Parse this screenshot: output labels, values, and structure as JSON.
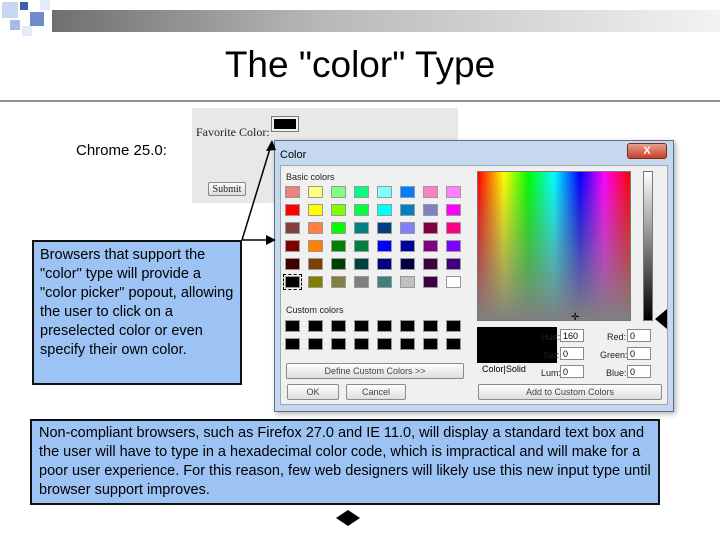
{
  "slide": {
    "title": "The \"color\" Type"
  },
  "chrome_example": {
    "browser_label": "Chrome 25.0:",
    "favorite_label": "Favorite Color:",
    "submit_label": "Submit"
  },
  "color_dialog": {
    "title": "Color",
    "close_label": "X",
    "basic_colors_label": "Basic colors",
    "custom_colors_label": "Custom colors",
    "define_custom_label": "Define Custom Colors >>",
    "ok_label": "OK",
    "cancel_label": "Cancel",
    "add_custom_label": "Add to Custom Colors",
    "color_solid_label": "Color|Solid",
    "fields": {
      "hue": {
        "label": "Hue:",
        "value": "160"
      },
      "sat": {
        "label": "Sat:",
        "value": "0"
      },
      "lum": {
        "label": "Lum:",
        "value": "0"
      },
      "red": {
        "label": "Red:",
        "value": "0"
      },
      "green": {
        "label": "Green:",
        "value": "0"
      },
      "blue": {
        "label": "Blue:",
        "value": "0"
      }
    },
    "basic_colors": [
      [
        "#f08080",
        "#ffff80",
        "#80ff80",
        "#00ff80",
        "#80ffff",
        "#0080ff",
        "#ff80c0",
        "#ff80ff"
      ],
      [
        "#ff0000",
        "#ffff00",
        "#80ff00",
        "#00ff40",
        "#00ffff",
        "#0080c0",
        "#8080c0",
        "#ff00ff"
      ],
      [
        "#804040",
        "#ff8040",
        "#00ff00",
        "#008080",
        "#004080",
        "#8080ff",
        "#800040",
        "#ff0080"
      ],
      [
        "#800000",
        "#ff8000",
        "#008000",
        "#008040",
        "#0000ff",
        "#0000a0",
        "#800080",
        "#8000ff"
      ],
      [
        "#400000",
        "#804000",
        "#004000",
        "#004040",
        "#000080",
        "#000040",
        "#400040",
        "#400080"
      ],
      [
        "#000000",
        "#808000",
        "#808040",
        "#808080",
        "#408080",
        "#c0c0c0",
        "#400040",
        "#ffffff"
      ]
    ],
    "custom_colors": [
      [
        "#000000",
        "#000000",
        "#000000",
        "#000000",
        "#000000",
        "#000000",
        "#000000",
        "#000000"
      ],
      [
        "#000000",
        "#000000",
        "#000000",
        "#000000",
        "#000000",
        "#000000",
        "#000000",
        "#000000"
      ]
    ]
  },
  "callouts": {
    "support_text": "Browsers that support the \"color\" type will provide a \"color picker\" popout, allowing the user to click on a preselected color or even specify their own color.",
    "noncompliant_text": "Non-compliant browsers, such as Firefox 27.0 and IE 11.0, will display a standard text box and the user will have to type in a hexadecimal color code, which is impractical and will make for a poor user experience.  For this reason, few web designers will likely use this new input type until browser support improves."
  },
  "colors": {
    "callout_fill": "#9cc3f4",
    "dialog_frame": "#c6d8ed"
  }
}
